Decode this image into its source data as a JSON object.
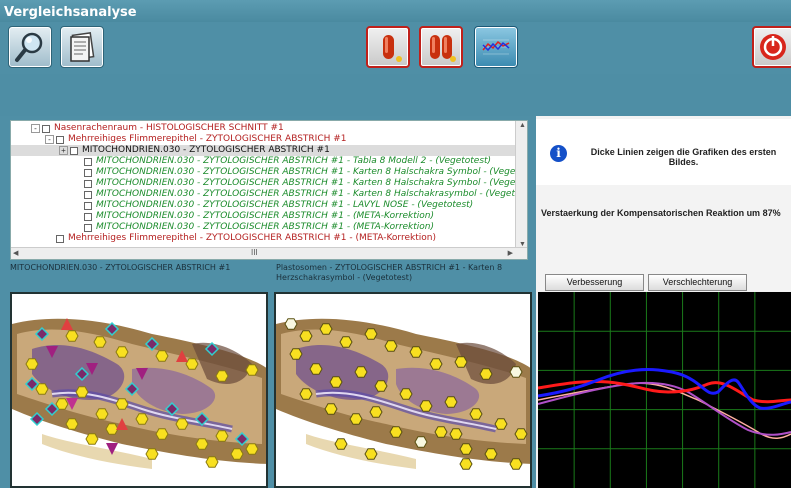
{
  "window": {
    "title": "Vergleichsanalyse"
  },
  "toolbar": {
    "buttons": [
      {
        "name": "magnifier-icon"
      },
      {
        "name": "document-icon"
      },
      {
        "name": "single-capsule-icon"
      },
      {
        "name": "double-capsule-icon"
      },
      {
        "name": "wave-graph-icon"
      },
      {
        "name": "power-icon"
      }
    ]
  },
  "tree": {
    "rows": [
      {
        "text": "Nasenrachenraum - HISTOLOGISCHER SCHNITT #1",
        "color": "red",
        "indent": 0,
        "expander": "-"
      },
      {
        "text": "Mehrreihiges Flimmerepithel - ZYTOLOGISCHER ABSTRICH #1",
        "color": "red",
        "indent": 1,
        "expander": "-"
      },
      {
        "text": "MITOCHONDRIEN.030 - ZYTOLOGISCHER ABSTRICH #1",
        "color": "black",
        "indent": 2,
        "expander": "+",
        "selected": true
      },
      {
        "text": "MITOCHONDRIEN.030 - ZYTOLOGISCHER ABSTRICH #1 - Tabla 8 Modell 2 - (Vegetotest)",
        "color": "green",
        "indent": 3
      },
      {
        "text": "MITOCHONDRIEN.030 - ZYTOLOGISCHER ABSTRICH #1 - Karten 8 Halschakra Symbol - (Vegetu",
        "color": "green",
        "indent": 3
      },
      {
        "text": "MITOCHONDRIEN.030 - ZYTOLOGISCHER ABSTRICH #1 - Karten 8 Halschakra Symbol - (Vegetu",
        "color": "green",
        "indent": 3
      },
      {
        "text": "MITOCHONDRIEN.030 - ZYTOLOGISCHER ABSTRICH #1 - Karten 8 Halschakrasymbol - (Vegetot",
        "color": "green",
        "indent": 3
      },
      {
        "text": "MITOCHONDRIEN.030 - ZYTOLOGISCHER ABSTRICH #1 - LAVYL NOSE - (Vegetotest)",
        "color": "green",
        "indent": 3
      },
      {
        "text": "MITOCHONDRIEN.030 - ZYTOLOGISCHER ABSTRICH #1 - (META-Korrektion)",
        "color": "green",
        "indent": 3
      },
      {
        "text": "MITOCHONDRIEN.030 - ZYTOLOGISCHER ABSTRICH #1 - (META-Korrektion)",
        "color": "green",
        "indent": 3
      },
      {
        "text": "Mehrreihiges Flimmerepithel - ZYTOLOGISCHER ABSTRICH #1 - (META-Korrektion)",
        "color": "red",
        "indent": 1
      }
    ],
    "hscroll_grip": "III"
  },
  "captions": {
    "left": "MITOCHONDRIEN.030 - ZYTOLOGISCHER ABSTRICH #1",
    "right_line1": "Plastosomen - ZYTOLOGISCHER ABSTRICH #1 - Karten 8",
    "right_line2": "Herzschakrasymbol - (Vegetotest)"
  },
  "info": {
    "icon": "info-icon",
    "text": "Dicke Linien zeigen die Grafiken des ersten Bildes."
  },
  "reaction": {
    "text": "Verstaerkung der Kompensatorischen Reaktion um 87%"
  },
  "buttons": {
    "improve": "Verbesserung",
    "worsen": "Verschlechterung"
  },
  "colors": {
    "accent": "#4f8fa6",
    "red_series": "#ff1a1a",
    "blue_series": "#1a1aff",
    "purple_series": "#b050c8",
    "pink_series": "#ffb0a0",
    "grid": "#1a7a1a"
  }
}
